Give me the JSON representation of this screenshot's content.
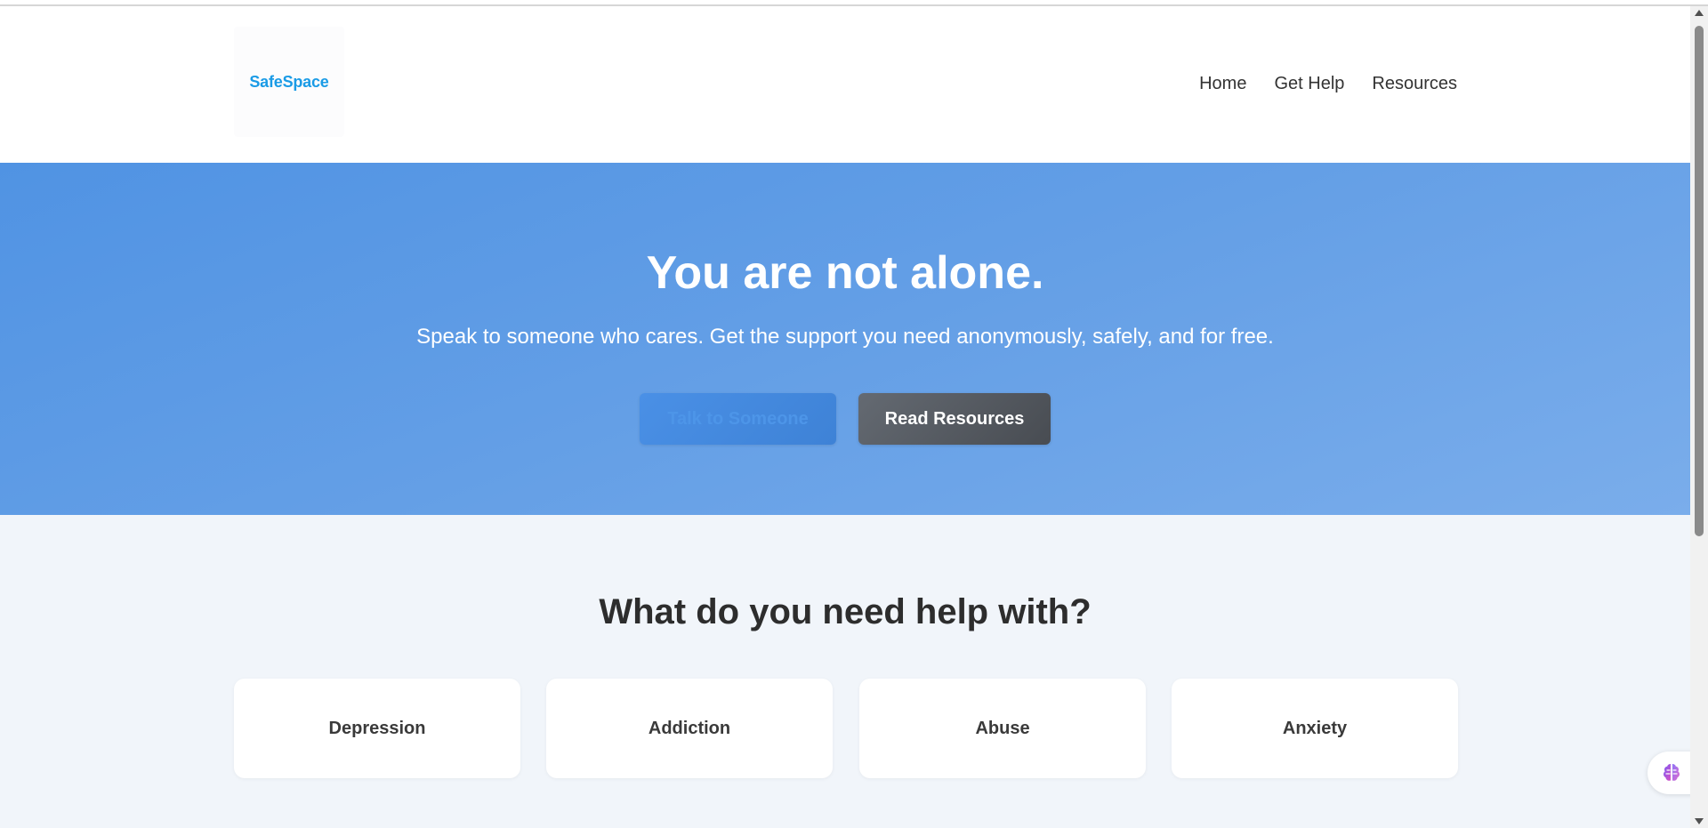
{
  "header": {
    "logo_text": "SafeSpace",
    "nav": [
      {
        "label": "Home"
      },
      {
        "label": "Get Help"
      },
      {
        "label": "Resources"
      }
    ]
  },
  "hero": {
    "title": "You are not alone.",
    "subtitle": "Speak to someone who cares. Get the support you need anonymously, safely, and for free.",
    "primary_button": "Talk to Someone",
    "secondary_button": "Read Resources"
  },
  "help": {
    "title": "What do you need help with?",
    "cards": [
      {
        "label": "Depression"
      },
      {
        "label": "Addiction"
      },
      {
        "label": "Abuse"
      },
      {
        "label": "Anxiety"
      }
    ]
  },
  "widget": {
    "icon": "brain-icon"
  },
  "colors": {
    "brand": "#1a9be6",
    "hero_start": "#5093e3",
    "hero_end": "#7aadeb",
    "secondary_button": "#555a61",
    "section_bg": "#f1f5fa"
  }
}
